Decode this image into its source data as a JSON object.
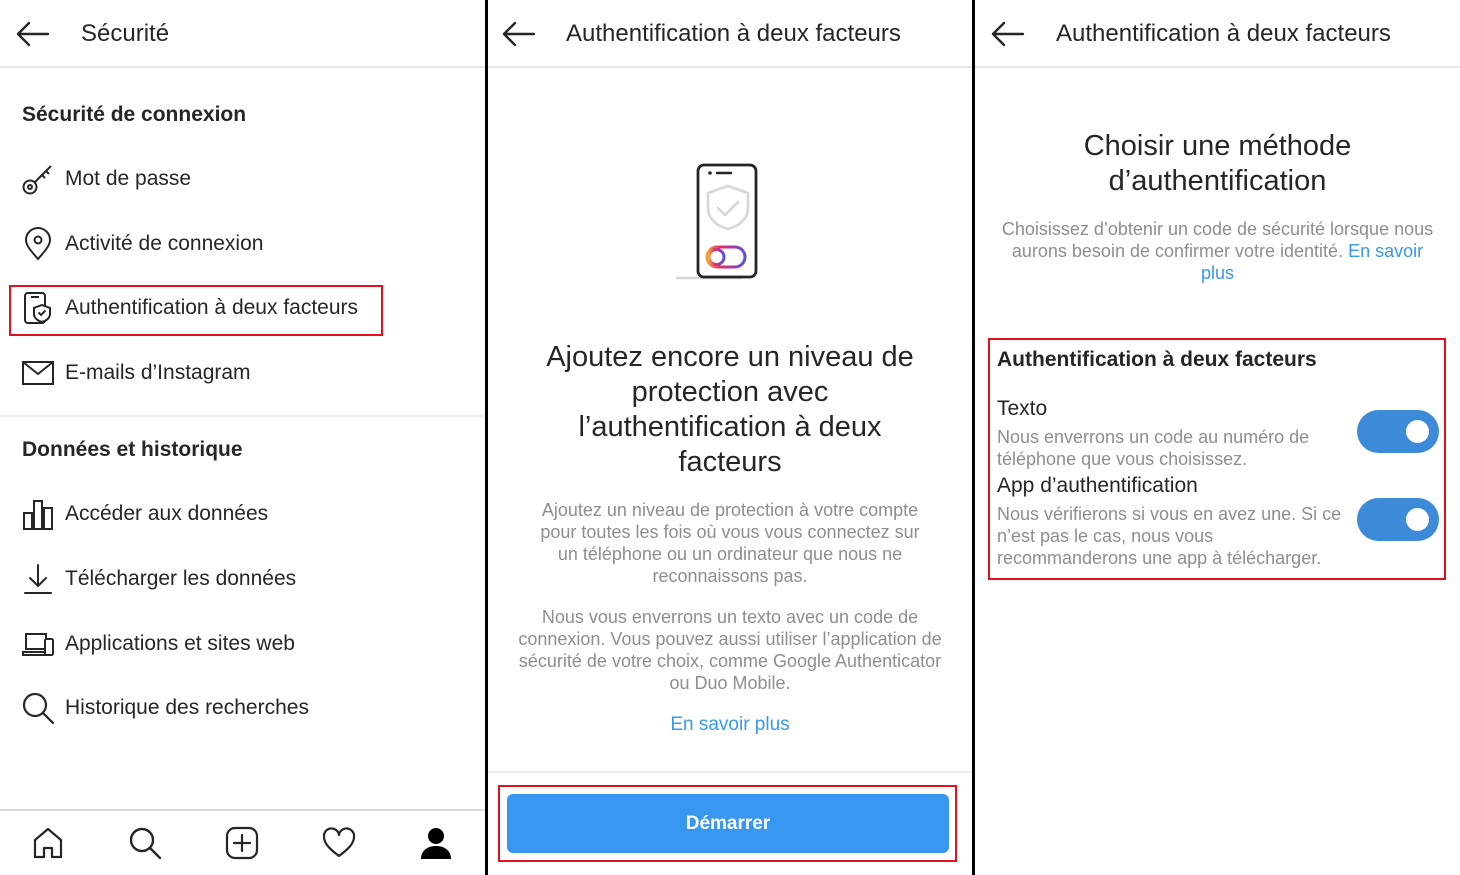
{
  "panel1": {
    "header": {
      "title": "Sécurité"
    },
    "sections": [
      {
        "heading": "Sécurité de connexion",
        "items": [
          {
            "label": "Mot de passe",
            "icon": "key-icon"
          },
          {
            "label": "Activité de connexion",
            "icon": "location-pin-icon"
          },
          {
            "label": "Authentification à deux facteurs",
            "icon": "phone-shield-icon",
            "highlighted": true
          },
          {
            "label": "E-mails d’Instagram",
            "icon": "envelope-icon"
          }
        ]
      },
      {
        "heading": "Données et historique",
        "items": [
          {
            "label": "Accéder aux données",
            "icon": "bar-chart-icon"
          },
          {
            "label": "Télécharger les données",
            "icon": "download-icon"
          },
          {
            "label": "Applications et sites web",
            "icon": "devices-icon"
          },
          {
            "label": "Historique des recherches",
            "icon": "search-icon"
          }
        ]
      }
    ],
    "bottom_nav": [
      "home-icon",
      "search-icon",
      "new-post-icon",
      "heart-icon",
      "profile-icon"
    ]
  },
  "panel2": {
    "header": {
      "title": "Authentification à deux facteurs"
    },
    "illustration": "phone-shield-illustration",
    "heading": "Ajoutez encore un niveau de protection avec l’authentification à deux facteurs",
    "body1": "Ajoutez un niveau de protection à votre compte pour toutes les fois où vous vous connectez sur un téléphone ou un ordinateur que nous ne reconnaissons pas.",
    "body2": "Nous vous enverrons un texto avec un code de connexion. Vous pouvez aussi utiliser l’application de sécurité de votre choix, comme Google Authenticator ou Duo Mobile.",
    "learn_more": "En savoir plus",
    "start_button": "Démarrer"
  },
  "panel3": {
    "header": {
      "title": "Authentification à deux facteurs"
    },
    "heading": "Choisir une méthode d’authentification",
    "description": "Choisissez d’obtenir un code de sécurité lorsque nous aurons besoin de confirmer votre identité.",
    "learn_more": "En savoir plus",
    "options_heading": "Authentification à deux facteurs",
    "options": [
      {
        "title": "Texto",
        "description": "Nous enverrons un code au numéro de téléphone que vous choisissez.",
        "enabled": true
      },
      {
        "title": "App d’authentification",
        "description": "Nous vérifierons si vous en avez une. Si ce n’est pas le cas, nous vous recommanderons une app à télécharger.",
        "enabled": true
      }
    ]
  },
  "colors": {
    "accent_blue": "#3897f0",
    "toggle_blue": "#3d8bd8",
    "highlight_red": "#e3101d",
    "secondary_text": "#8e8e8e"
  }
}
